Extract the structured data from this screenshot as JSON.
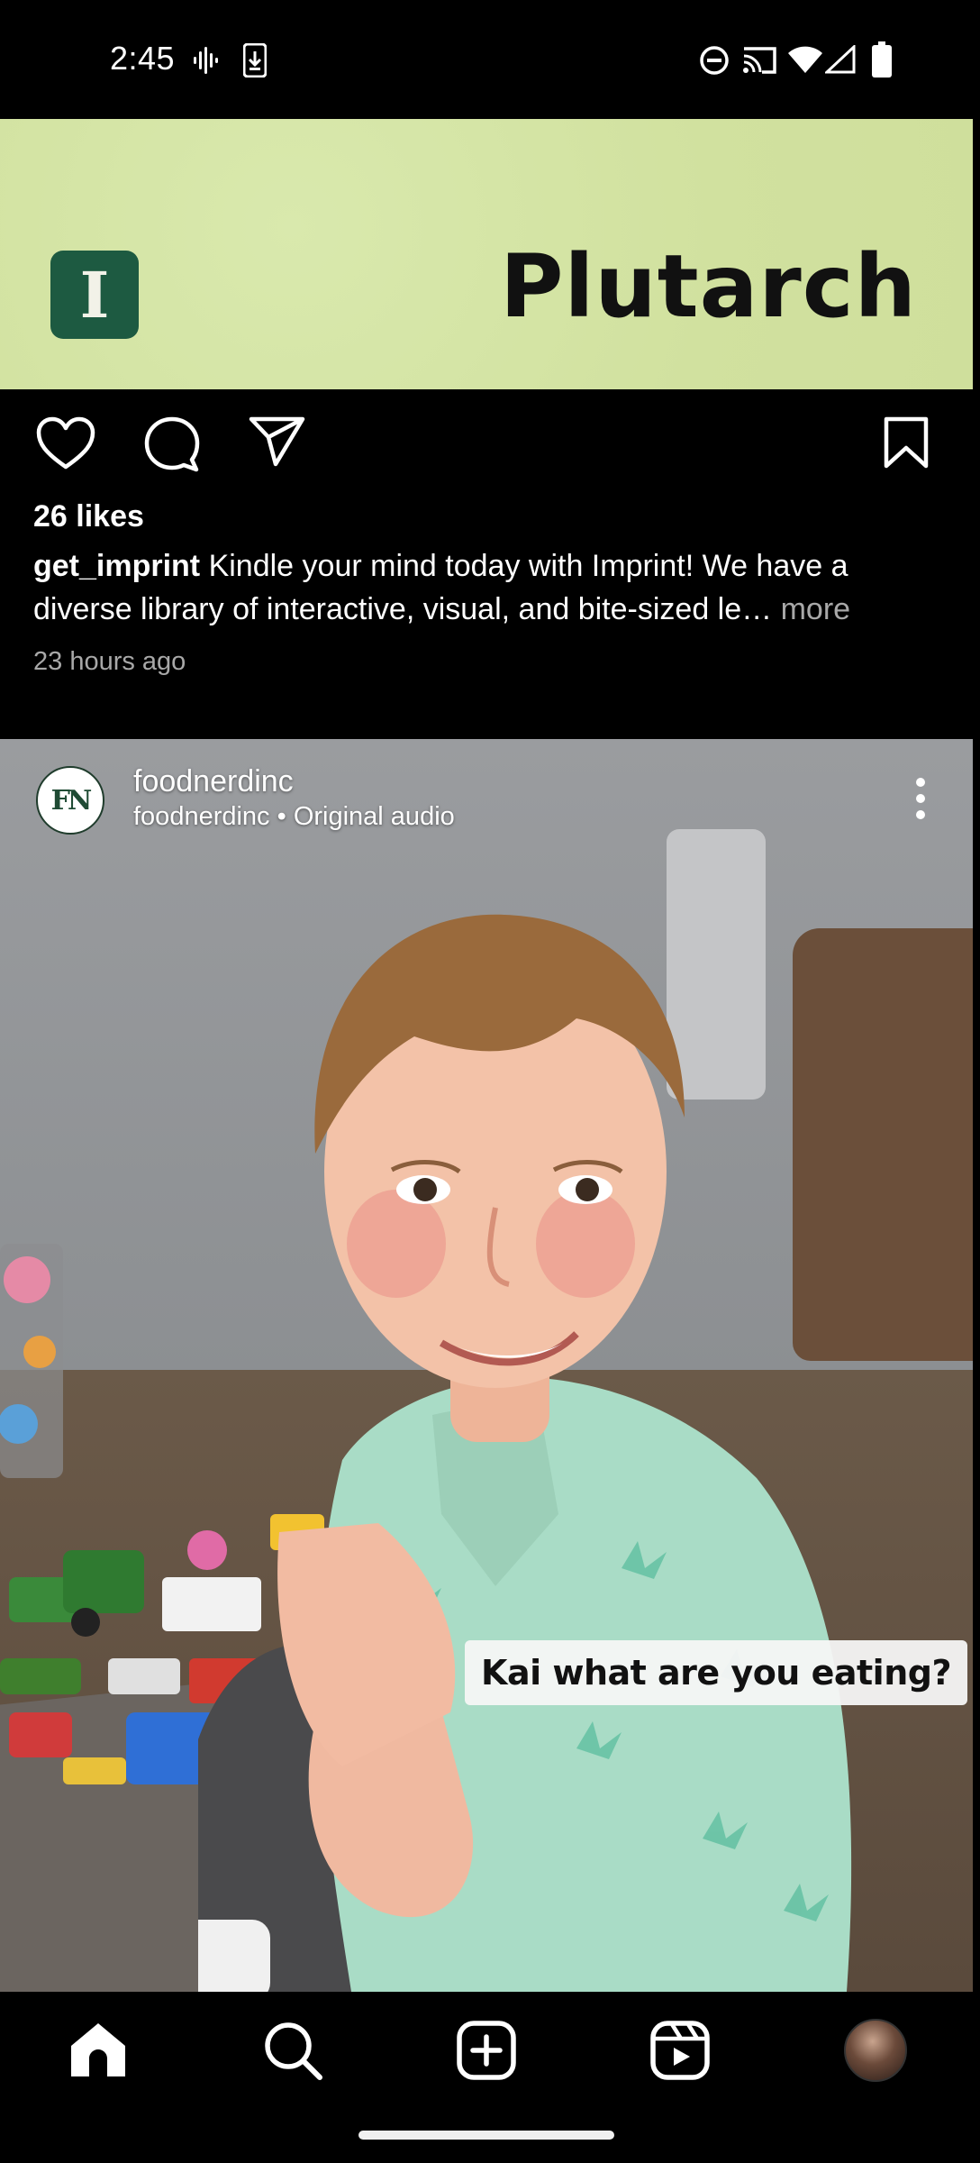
{
  "status_bar": {
    "time": "2:45",
    "icons": [
      "voicemail-icon",
      "download-icon",
      "do-not-disturb-icon",
      "cast-icon",
      "wifi-icon",
      "signal-icon",
      "battery-icon"
    ]
  },
  "ad": {
    "logo_letter": "I",
    "brand": "Plutarch",
    "background_color": "#d3e4a3",
    "logo_color": "#1d5a41"
  },
  "post": {
    "likes": "26 likes",
    "username": "get_imprint",
    "caption_text": "Kindle your mind today with Imprint! We have a diverse library of interactive, visual, and bite-sized le…",
    "more_label": "more",
    "timestamp": "23 hours ago",
    "actions": [
      "heart-icon",
      "comment-icon",
      "share-icon",
      "bookmark-icon"
    ]
  },
  "reel": {
    "avatar_initials": "FN",
    "username": "foodnerdinc",
    "subtitle": "foodnerdinc • Original audio",
    "caption_overlay": "Kai what are you eating?"
  },
  "nav": {
    "items": [
      "home-icon",
      "search-icon",
      "create-icon",
      "reels-icon",
      "profile-avatar"
    ]
  }
}
